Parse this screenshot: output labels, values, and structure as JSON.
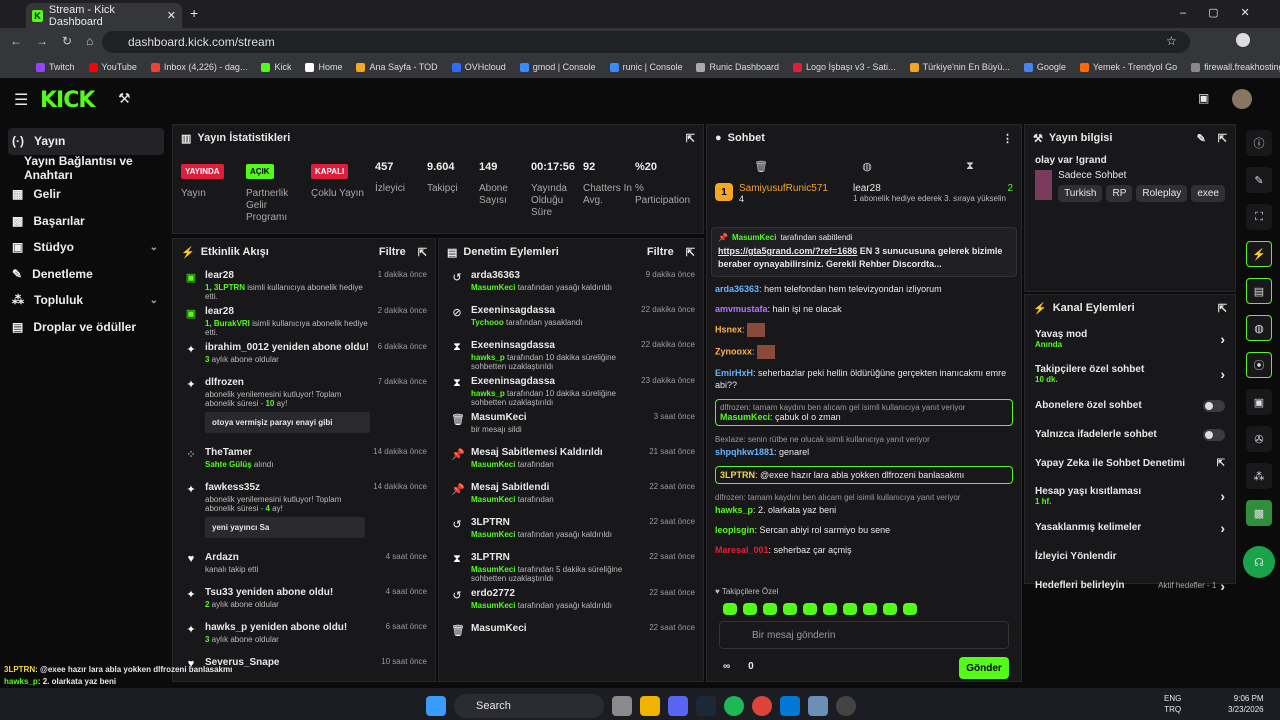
{
  "browser": {
    "tab_title": "Stream - Kick Dashboard",
    "url": "dashboard.kick.com/stream",
    "bookmarks": [
      "Twitch",
      "YouTube",
      "Inbox (4,226) - dag...",
      "Kick",
      "Home",
      "Ana Sayfa - TOD",
      "OVHcloud",
      "gmod | Console",
      "runic | Console",
      "Runic Dashboard",
      "Logo İşbaşı v3 - Sati...",
      "Türkiye'nin En Büyü...",
      "Google",
      "Yemek - Trendyol Go",
      "firewall.freakhosting..."
    ]
  },
  "sidebar": {
    "items": [
      "Yayın",
      "Yayın Bağlantısı ve Anahtarı",
      "Gelir",
      "Başarılar",
      "Stüdyo",
      "Denetleme",
      "Topluluk",
      "Droplar ve ödüller"
    ]
  },
  "stats": {
    "title": "Yayın İstatistikleri",
    "badges": [
      {
        "text": "YAYINDA",
        "label": "Yayın",
        "color": "#e01e3c"
      },
      {
        "text": "AÇIK",
        "label": "Partnerlik Gelir Programı",
        "color": "#53fc18"
      },
      {
        "text": "KAPALI",
        "label": "Çoklu Yayın",
        "color": "#e01e3c"
      }
    ],
    "metrics": [
      {
        "value": "457",
        "label": "İzleyici"
      },
      {
        "value": "9.604",
        "label": "Takipçi"
      },
      {
        "value": "149",
        "label": "Abone Sayısı"
      },
      {
        "value": "00:17:56",
        "label": "Yayında Olduğu Süre"
      },
      {
        "value": "92",
        "label": "Chatters In Avg."
      },
      {
        "value": "%20",
        "label": "% Participation"
      }
    ]
  },
  "activity": {
    "title": "Etkinlik Akışı",
    "filter": "Filtre",
    "events": [
      {
        "icon": "gift",
        "name": "lear28",
        "desc_g": "1, 3LPTRN",
        "desc": " isimli kullanıcıya abonelik hediye etti.",
        "time": "1 dakika önce"
      },
      {
        "icon": "gift",
        "name": "lear28",
        "desc_g": "1, BurakVRI",
        "desc": " isimli kullanıcıya abonelik hediye etti.",
        "time": "2 dakika önce"
      },
      {
        "icon": "star",
        "name": "ibrahim_0012 yeniden abone oldu!",
        "desc_g": "3",
        "desc": " aylık abone oldular",
        "time": "6 dakika önce"
      },
      {
        "icon": "star",
        "name": "dlfrozen",
        "desc_g": "",
        "desc": "abonelik yenilemesini kutluyor! Toplam abonelik süresi - ",
        "desc_tail": "10",
        "desc_end": " ay!",
        "quote": "otoya vermişiz parayı enayi gibi",
        "time": "7 dakika önce"
      },
      {
        "icon": "dots",
        "name": "TheTamer",
        "desc_g": "Sahte Gülüş",
        "desc": " alındı",
        "time": "14 dakika önce"
      },
      {
        "icon": "star",
        "name": "fawkess35z",
        "desc_g": "",
        "desc": "abonelik yenilemesini kutluyor! Toplam abonelik süresi - ",
        "desc_tail": "4",
        "desc_end": " ay!",
        "quote": "yeni yayıncı Sa",
        "time": "14 dakika önce"
      },
      {
        "icon": "heart",
        "name": "Ardazn",
        "desc_g": "",
        "desc": "kanalı takip etti",
        "time": "4 saat önce"
      },
      {
        "icon": "star",
        "name": "Tsu33 yeniden abone oldu!",
        "desc_g": "2",
        "desc": " aylık abone oldular",
        "time": "4 saat önce"
      },
      {
        "icon": "star",
        "name": "hawks_p yeniden abone oldu!",
        "desc_g": "3",
        "desc": " aylık abone oldular",
        "time": "6 saat önce"
      },
      {
        "icon": "heart",
        "name": "Severus_Snape",
        "desc_g": "",
        "desc": "",
        "time": "10 saat önce"
      }
    ]
  },
  "moderation": {
    "title": "Denetim Eylemleri",
    "filter": "Filtre",
    "events": [
      {
        "icon": "undo",
        "name": "arda36363",
        "desc_g": "MasumKeci",
        "desc": " tarafından yasağı kaldırıldı",
        "time": "9 dakika önce"
      },
      {
        "icon": "ban",
        "name": "Exeeninsagdassa",
        "desc_g": "Tychooo",
        "desc": " tarafından yasaklandı",
        "time": "22 dakika önce"
      },
      {
        "icon": "timer",
        "name": "Exeeninsagdassa",
        "desc_g": "hawks_p",
        "desc": " tarafından 10 dakika süreliğine sohbetten uzaklaştırıldı",
        "time": "22 dakika önce"
      },
      {
        "icon": "timer",
        "name": "Exeeninsagdassa",
        "desc_g": "hawks_p",
        "desc": " tarafından 10 dakika süreliğine sohbetten uzaklaştırıldı",
        "time": "23 dakika önce"
      },
      {
        "icon": "trash",
        "name": "MasumKeci",
        "desc_g": "",
        "desc": "bir mesajı sildi",
        "time": "3 saat önce"
      },
      {
        "icon": "pin",
        "name": "Mesaj Sabitlemesi Kaldırıldı",
        "desc_g": "MasumKeci",
        "desc": " tarafından",
        "time": "21 saat önce"
      },
      {
        "icon": "pin",
        "name": "Mesaj Sabitlendi",
        "desc_g": "MasumKeci",
        "desc": " tarafından",
        "time": "22 saat önce"
      },
      {
        "icon": "undo",
        "name": "3LPTRN",
        "desc_g": "MasumKeci",
        "desc": " tarafından yasağı kaldırıldı",
        "time": "22 saat önce"
      },
      {
        "icon": "timer",
        "name": "3LPTRN",
        "desc_g": "MasumKeci",
        "desc": " tarafından 5 dakika süreliğine sohbetten uzaklaştırıldı",
        "time": "22 saat önce"
      },
      {
        "icon": "undo",
        "name": "erdo2772",
        "desc_g": "MasumKeci",
        "desc": " tarafından yasağı kaldırıldı",
        "time": "22 saat önce"
      },
      {
        "icon": "trash",
        "name": "MasumKeci",
        "desc_g": "",
        "desc": "",
        "time": "22 saat önce"
      }
    ]
  },
  "chat": {
    "title": "Sohbet",
    "top_gifter": {
      "rank": "1",
      "name": "SamiyusufRunic571",
      "count": "4"
    },
    "gift_notice": {
      "name": "lear28",
      "count": "2",
      "text": "1 abonelik hediye ederek 3. sıraya yükselin"
    },
    "pinned": {
      "by": "MasumKeci",
      "by_suffix": "tarafından sabitlendi",
      "link": "https://gta5grand.com/?ref=1686",
      "text": " EN 3 sunucusuna gelerek bizimle beraber oynayabilirsiniz. Gerekli Rehber Discordta..."
    },
    "messages": [
      {
        "user": "arda36363",
        "color": "#64b5ff",
        "text": "hem telefondan hem televizyondan izliyorum"
      },
      {
        "user": "amvmustafa",
        "color": "#b176ff",
        "text": "hain işi ne olacak"
      },
      {
        "user": "Hsnex",
        "color": "#ffb347",
        "text": ""
      },
      {
        "user": "Zynooxx",
        "color": "#ffb347",
        "text": ""
      },
      {
        "user": "EmirHxH",
        "color": "#64b5ff",
        "text": "seherbazlar peki hellin öldürüğüne gerçekten inanıcakmı emre abi??"
      },
      {
        "reply": "dlfrozen: tamam kaydını ben alıcam gel isimli kullanıcıya yanıt veriyor",
        "user": "MasumKeci",
        "color": "#53fc18",
        "text": "çabuk ol o zman",
        "highlight": true
      },
      {
        "reply": "Bexlaze: senin rütbe ne olucak isimli kullanıcıya yanıt veriyor",
        "user": "shpqhkw1881",
        "color": "#64b5ff",
        "text": "genarel"
      },
      {
        "user": "3LPTRN",
        "color": "#f5d742",
        "text": "@exee hazır lara abla yokken dlfrozeni banlasakmı",
        "highlight": true
      },
      {
        "reply": "dlfrozen: tamam kaydını ben alıcam gel isimli kullanıcıya yanıt veriyor",
        "user": "hawks_p",
        "color": "#53fc18",
        "text": "2. olarkata yaz beni"
      },
      {
        "user": "leopisgin",
        "color": "#53fc18",
        "text": "Sercan abiyi rol sarmiyo bu sene"
      },
      {
        "user": "Maresal_001",
        "color": "#e01e3c",
        "text": "seherbaz çar açmiş"
      }
    ],
    "emote_label": "Takipçilere Özel",
    "input_placeholder": "Bir mesaj gönderin",
    "send": "Gönder",
    "bottom_count_a": "∞",
    "bottom_count_b": "0"
  },
  "stream_info": {
    "title": "Yayın bilgisi",
    "stream_title": "olay var !grand",
    "category": "Sadece Sohbet",
    "tags": [
      "Turkish",
      "RP",
      "Roleplay",
      "exee"
    ]
  },
  "channel_actions": {
    "title": "Kanal Eylemleri",
    "items": [
      {
        "label": "Yavaş mod",
        "sub": "Anında",
        "control": "arrow"
      },
      {
        "label": "Takipçilere özel sohbet",
        "sub": "10 dk.",
        "control": "arrow"
      },
      {
        "label": "Abonelere özel sohbet",
        "sub": "",
        "control": "toggle"
      },
      {
        "label": "Yalnızca ifadelerle sohbet",
        "sub": "",
        "control": "toggle"
      },
      {
        "label": "Yapay Zeka ile Sohbet Denetimi",
        "sub": "",
        "control": "ext"
      },
      {
        "label": "Hesap yaşı kısıtlaması",
        "sub": "1 hf.",
        "control": "arrow"
      },
      {
        "label": "Yasaklanmış kelimeler",
        "sub": "",
        "control": "arrow"
      },
      {
        "label": "İzleyici Yönlendir",
        "sub": "",
        "control": "none"
      },
      {
        "label": "Hedefleri belirleyin",
        "sub": "",
        "control": "goal",
        "goal": "Aktif hedefler - 1"
      }
    ]
  },
  "overlay": [
    {
      "user": "3LPTRN",
      "color": "#f5d742",
      "text": "@exee hazır lara abla yokken dlfrozeni banlasakmı"
    },
    {
      "user": "hawks_p",
      "color": "#53fc18",
      "text": "2. olarkata yaz beni"
    },
    {
      "user": "leopisgin",
      "color": "#53fc18",
      "text": "Sercan abiyi rol sarmiyo bu sene"
    },
    {
      "user": "Maresal_001",
      "color": "#e01e3c",
      "text": "seherbaz çar açmış"
    }
  ],
  "taskbar": {
    "search": "Search",
    "lang1": "ENG",
    "lang2": "TRQ",
    "time": "9:06 PM",
    "date": "3/23/2026"
  }
}
